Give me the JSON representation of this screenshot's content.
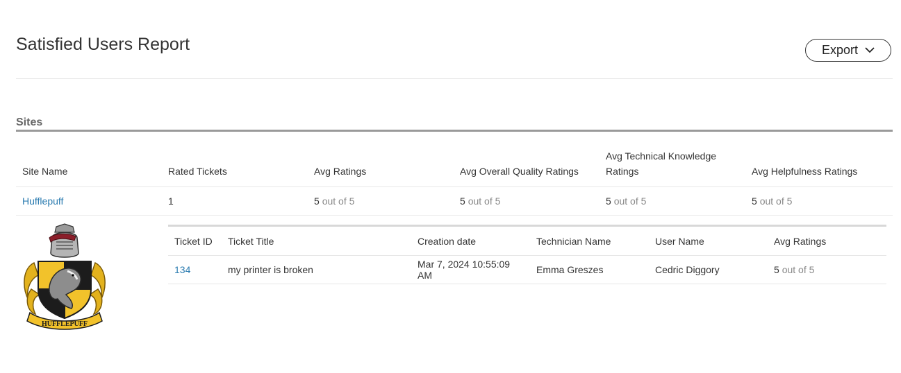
{
  "header": {
    "title": "Satisfied Users Report",
    "export_label": "Export"
  },
  "sites_section": {
    "title": "Sites",
    "columns": {
      "site_name": "Site Name",
      "rated_tickets": "Rated Tickets",
      "avg_ratings": "Avg Ratings",
      "avg_overall": "Avg Overall Quality Ratings",
      "avg_technical": "Avg Technical Knowledge Ratings",
      "avg_helpfulness": "Avg Helpfulness Ratings"
    },
    "rows": [
      {
        "site_name": "Hufflepuff",
        "rated_tickets": "1",
        "avg_ratings": {
          "value": "5",
          "suffix": "out of 5"
        },
        "avg_overall": {
          "value": "5",
          "suffix": "out of 5"
        },
        "avg_technical": {
          "value": "5",
          "suffix": "out of 5"
        },
        "avg_helpfulness": {
          "value": "5",
          "suffix": "out of 5"
        },
        "crest_text": "HUFFLEPUFF",
        "tickets": {
          "columns": {
            "ticket_id": "Ticket ID",
            "ticket_title": "Ticket Title",
            "creation_date": "Creation date",
            "technician_name": "Technician Name",
            "user_name": "User Name",
            "avg_ratings": "Avg Ratings"
          },
          "rows": [
            {
              "ticket_id": "134",
              "ticket_title": "my printer is broken",
              "creation_date": "Mar 7, 2024 10:55:09 AM",
              "technician_name": "Emma Greszes",
              "user_name": "Cedric Diggory",
              "avg_ratings": {
                "value": "5",
                "suffix": "out of 5"
              }
            }
          ]
        }
      }
    ]
  },
  "colors": {
    "link": "#2a7bb0",
    "muted_text": "#888888",
    "section_rule": "#9a9a9a",
    "crest_yellow": "#f2c22b",
    "crest_black": "#1c1c1c"
  },
  "icons": {
    "export_chevron": "chevron-down-icon",
    "crest": "hufflepuff-crest-icon"
  }
}
